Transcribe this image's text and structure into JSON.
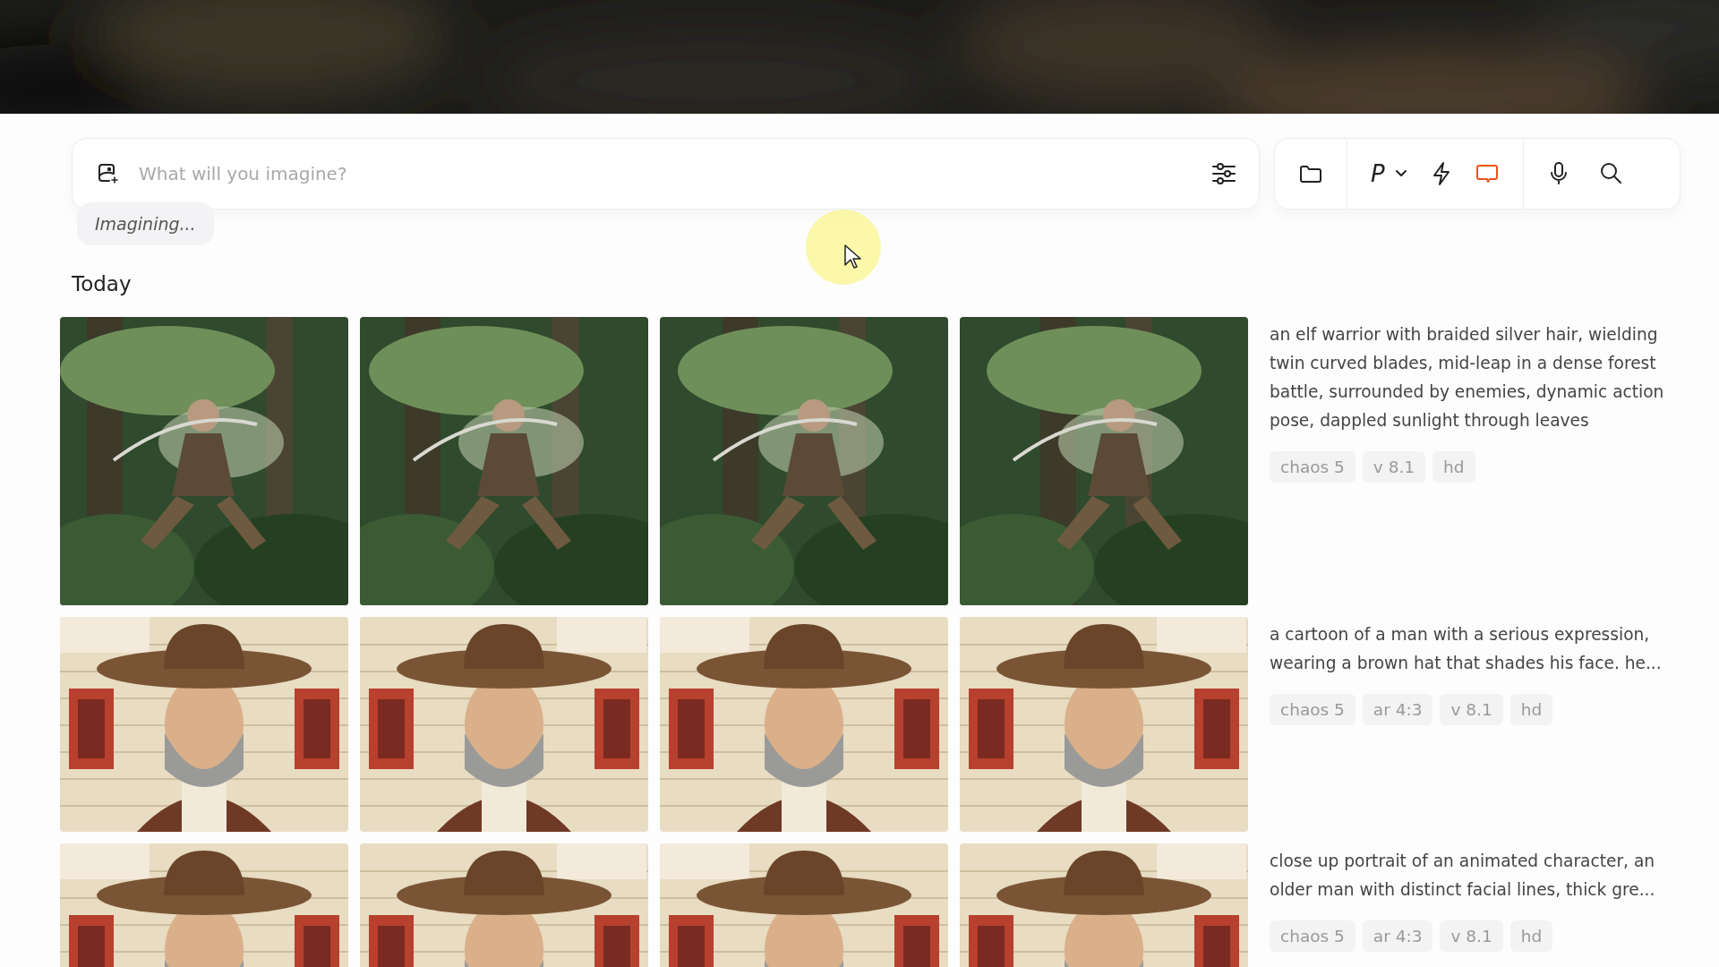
{
  "banner": {
    "kind": "picture"
  },
  "prompt_bar": {
    "placeholder": "What will you imagine?"
  },
  "toolbar": {
    "profile_label": "P",
    "chat_mode": {
      "on": true
    }
  },
  "status_chip": "Imagining...",
  "section_title": "Today",
  "jobs": [
    {
      "images": [
        {
          "kind": "picture"
        },
        {
          "kind": "picture"
        },
        {
          "kind": "picture"
        },
        {
          "kind": "picture"
        }
      ],
      "prompt": "an elf warrior with braided silver hair, wielding twin curved blades, mid-leap in a dense forest battle, surrounded by enemies, dynamic action pose, dappled sunlight through leaves",
      "tags": [
        "chaos 5",
        "v 8.1",
        "hd"
      ]
    },
    {
      "images": [
        {
          "kind": "picture"
        },
        {
          "kind": "picture"
        },
        {
          "kind": "picture"
        },
        {
          "kind": "picture"
        }
      ],
      "prompt": "a cartoon of a man with a serious expression, wearing a brown hat that shades his face. he...",
      "tags": [
        "chaos 5",
        "ar 4:3",
        "v 8.1",
        "hd"
      ]
    },
    {
      "images": [
        {
          "kind": "picture"
        },
        {
          "kind": "picture"
        },
        {
          "kind": "picture"
        },
        {
          "kind": "picture"
        }
      ],
      "prompt": "close up portrait of an animated character, an older man with distinct facial lines, thick gre...",
      "tags": [
        "chaos 5",
        "ar 4:3",
        "v 8.1",
        "hd"
      ]
    }
  ]
}
